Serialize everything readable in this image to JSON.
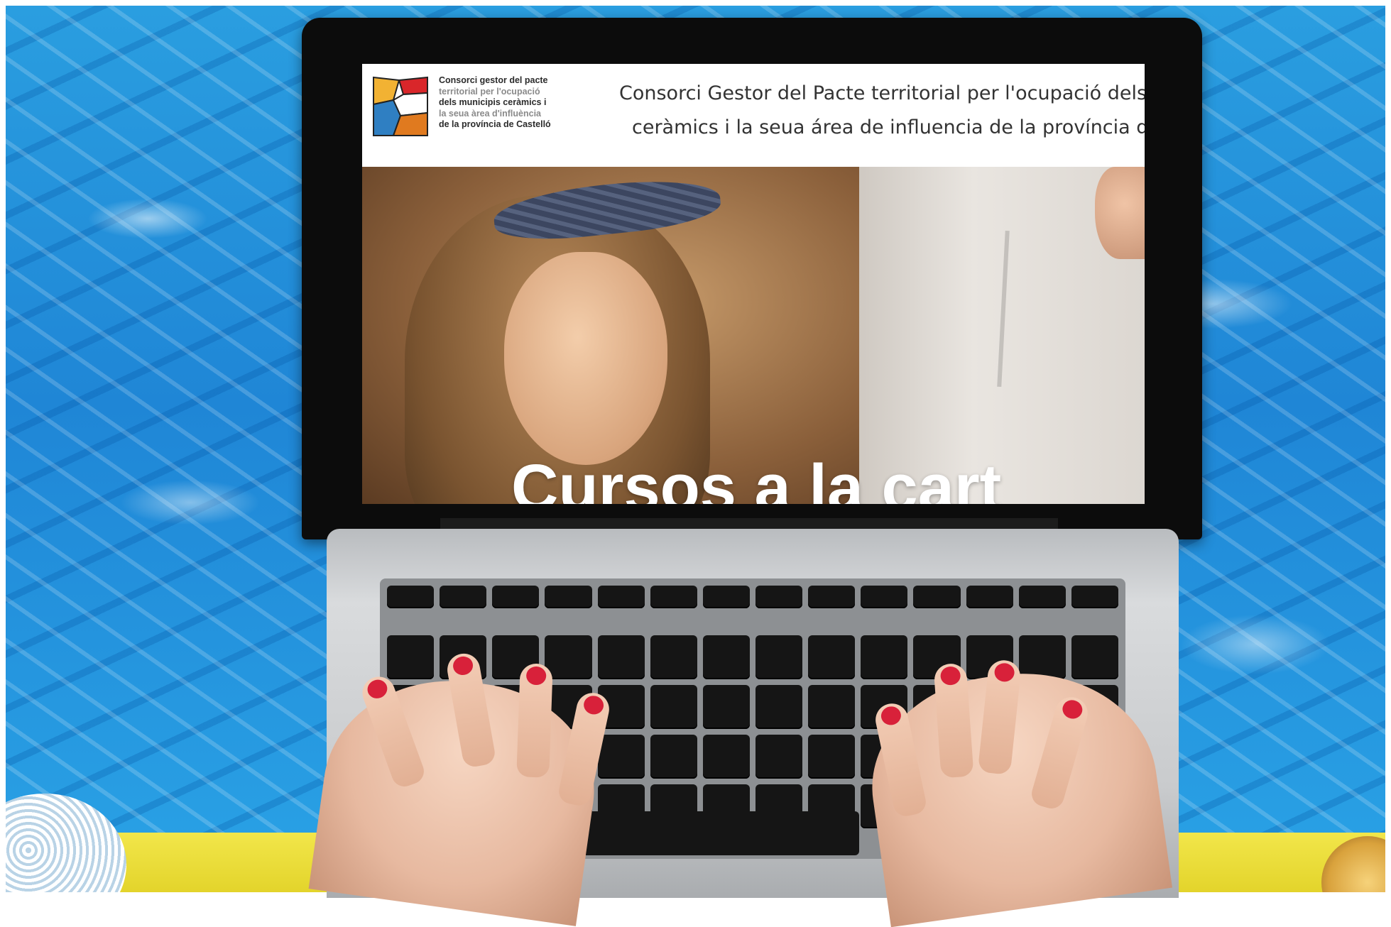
{
  "site": {
    "logo_text_lines": [
      "Consorci gestor del pacte",
      "territorial per l'ocupació",
      "dels municipis ceràmics i",
      "la seua àrea d'influència",
      "de la província de Castelló"
    ],
    "title_line1": "Consorci Gestor del Pacte territorial per l'ocupació dels",
    "title_line2": "ceràmics i la seua área de influencia de la província d",
    "hero_heading": "Cursos a la cart",
    "logo_colors": [
      "#f2b233",
      "#d9262a",
      "#2f7fc2",
      "#e07a1f",
      "#ffffff"
    ]
  },
  "scene": {
    "background": "swimming pool water",
    "deck_color": "#e9dc36",
    "nail_color": "#d8213a"
  },
  "icons": {
    "logo": "mosaic-logo-icon"
  }
}
